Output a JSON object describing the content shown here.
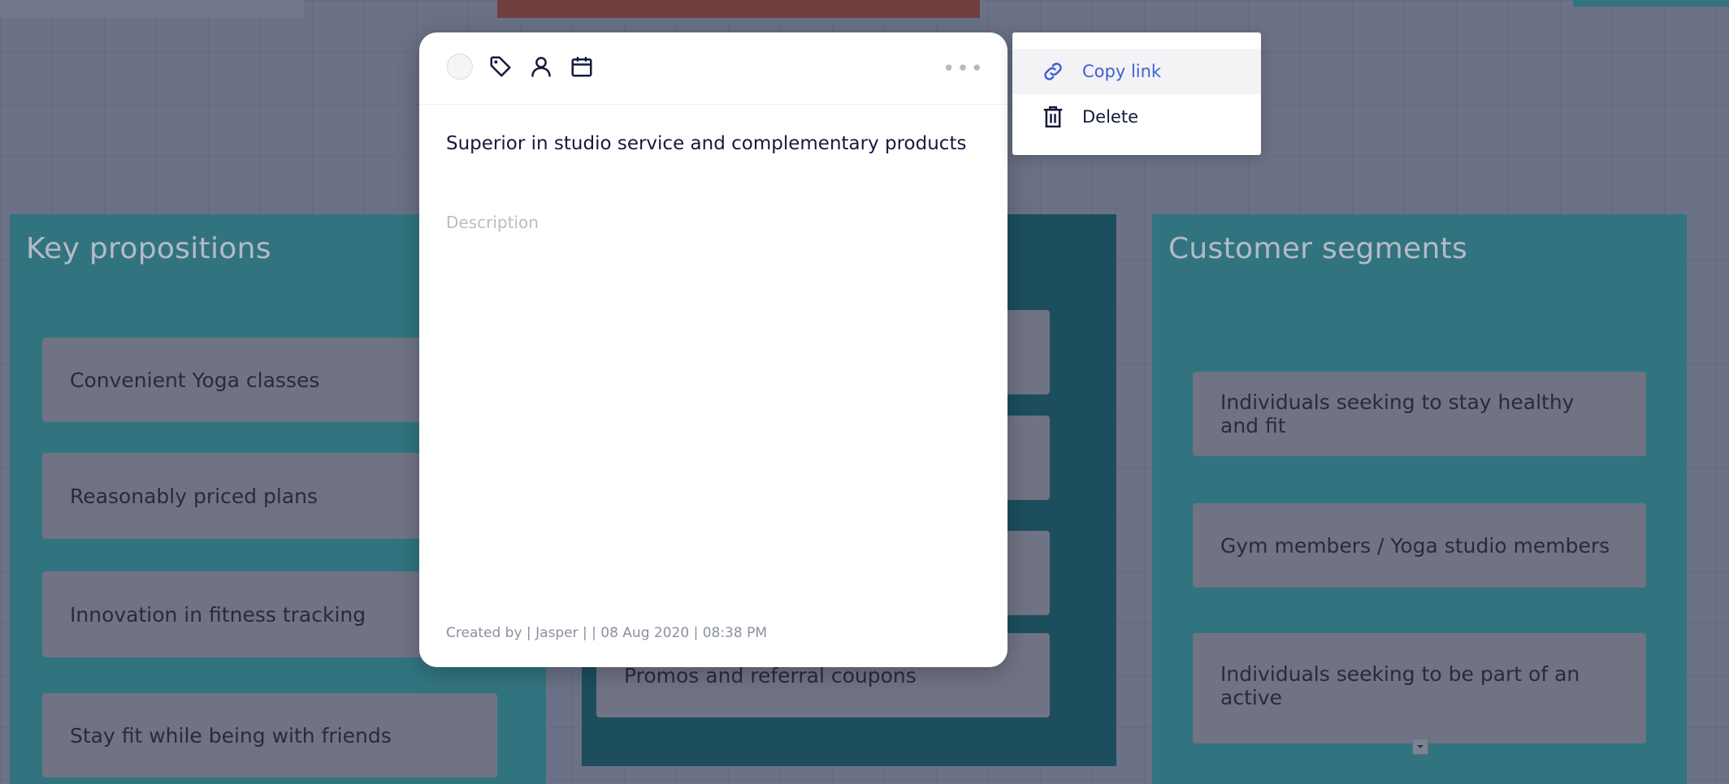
{
  "board": {
    "columns": [
      {
        "title": "Key propositions",
        "cards": [
          "Convenient Yoga classes",
          "Reasonably priced plans",
          "Innovation in fitness tracking",
          "Stay fit while being with friends"
        ]
      },
      {
        "title": "",
        "cards": [
          "",
          "",
          "",
          "Promos and referral coupons"
        ]
      },
      {
        "title": "Customer segments",
        "cards": [
          "Individuals seeking to stay healthy and fit",
          "Gym members / Yoga studio members",
          "Individuals seeking to be part of an active"
        ]
      }
    ]
  },
  "modal": {
    "title": "Superior in studio service and complementary products",
    "description_placeholder": "Description",
    "footer": "Created by | Jasper | | 08 Aug 2020 | 08:38 PM",
    "more_label": "•••",
    "toolbar_icons": [
      "status-circle",
      "tag-icon",
      "user-icon",
      "calendar-icon"
    ]
  },
  "menu": {
    "items": [
      {
        "label": "Copy link",
        "icon": "link-icon"
      },
      {
        "label": "Delete",
        "icon": "trash-icon"
      }
    ]
  },
  "colors": {
    "column_teal": "#3a8f96",
    "column_dark_teal": "#1f5e6a",
    "top_red": "#8c4a45",
    "accent_blue": "#3f5fd8",
    "title_navy": "#141a3a"
  }
}
